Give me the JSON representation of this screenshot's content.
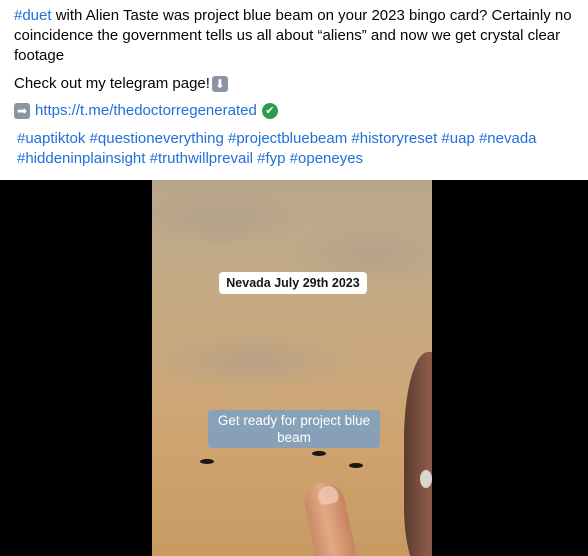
{
  "post": {
    "text": {
      "line1_tag": "#duet",
      "line1_rest": " with Alien Taste was project blue beam on your 2023 bingo card? Certainly no coincidence the government tells us all about “aliens” and now we get crystal clear footage",
      "telegram_text": "Check out my telegram page!",
      "down_arrow_emoji": "⬇",
      "right_arrow_emoji": "➡",
      "link": "https://t.me/thedoctorregenerated",
      "check_emoji": "✔",
      "hashtags": "#uaptiktok #questioneverything #projectbluebeam #historyreset #uap #nevada #hiddeninplainsight #truthwillprevail #fyp #openeyes"
    },
    "video": {
      "date_label": "Nevada July 29th 2023",
      "caption": "Get ready for project blue beam"
    }
  },
  "colors": {
    "link": "#216fdb",
    "caption_bg": "#7aa0c4",
    "check": "#2e9c4b"
  },
  "icons": [
    "down-arrow-emoji-icon",
    "right-arrow-emoji-icon",
    "check-mark-icon"
  ]
}
